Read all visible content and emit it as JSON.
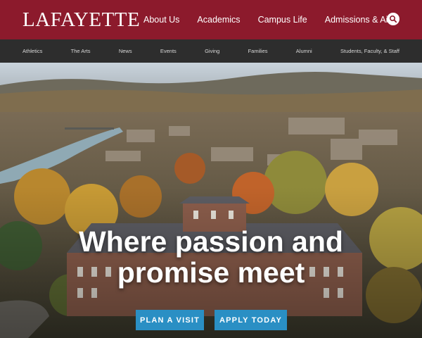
{
  "brand": {
    "logo_text": "LAFAYETTE"
  },
  "main_nav": [
    "About Us",
    "Academics",
    "Campus Life",
    "Admissions & Aid"
  ],
  "sub_nav": [
    "Athletics",
    "The Arts",
    "News",
    "Events",
    "Giving",
    "Families",
    "Alumni",
    "Students, Faculty, & Staff"
  ],
  "hero": {
    "headline_line1": "Where passion and",
    "headline_line2": "promise meet",
    "primary_cta": "PLAN A VISIT",
    "secondary_cta": "APPLY TODAY"
  },
  "icons": {
    "search": "search-icon"
  },
  "colors": {
    "header_bg": "#8c1a2c",
    "subnav_bg": "#2d2d2d",
    "cta_bg": "#2a8fc4"
  }
}
